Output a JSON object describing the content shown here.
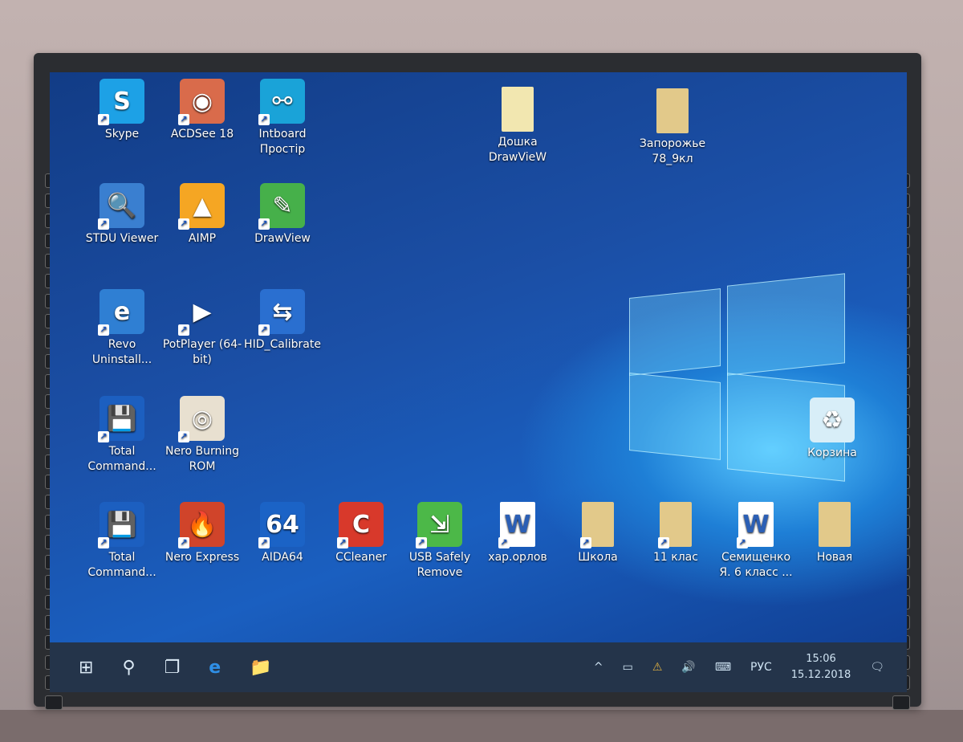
{
  "desktop": {
    "icons": [
      {
        "label": "Skype",
        "color": "#1da1e6",
        "glyph": "S"
      },
      {
        "label": "ACDSee 18",
        "color": "#d96b4b",
        "glyph": "◉"
      },
      {
        "label": "Intboard Простір",
        "color": "#1aa3d8",
        "glyph": "⚯"
      },
      {
        "label": "Дошка DrawVieW",
        "color": "#f2e7b0",
        "glyph": "",
        "folder": true
      },
      {
        "label": "Запорожье 78_9кл",
        "color": "#e2c98a",
        "glyph": "",
        "folder": true
      },
      {
        "label": "STDU Viewer",
        "color": "#3a7fd0",
        "glyph": "🔍"
      },
      {
        "label": "AIMP",
        "color": "#f5a623",
        "glyph": "▲"
      },
      {
        "label": "DrawView",
        "color": "#46b04a",
        "glyph": "✎"
      },
      {
        "label": "Revo Uninstall...",
        "color": "#2f7fd3",
        "glyph": "e"
      },
      {
        "label": "PotPlayer (64-bit)",
        "color": "#ffffff",
        "glyph": "▶"
      },
      {
        "label": "HID_Calibrate",
        "color": "#2a6fd0",
        "glyph": "⇆"
      },
      {
        "label": "Total Command...",
        "color": "#1c5fc0",
        "glyph": "💾"
      },
      {
        "label": "Nero Burning ROM",
        "color": "#e8e0d0",
        "glyph": "◎"
      },
      {
        "label": "Total Command...",
        "color": "#1c5fc0",
        "glyph": "💾"
      },
      {
        "label": "Nero Express",
        "color": "#d0442a",
        "glyph": "🔥"
      },
      {
        "label": "AIDA64",
        "color": "#1b63c6",
        "glyph": "64"
      },
      {
        "label": "CCleaner",
        "color": "#d8392b",
        "glyph": "C"
      },
      {
        "label": "USB Safely Remove",
        "color": "#4cb848",
        "glyph": "⇲"
      },
      {
        "label": "хар.орлов",
        "color": "#ffffff",
        "glyph": "W",
        "doc": true
      },
      {
        "label": "Школа",
        "color": "#e2c98a",
        "glyph": "",
        "folder": true
      },
      {
        "label": "11 клас",
        "color": "#e2c98a",
        "glyph": "",
        "folder": true
      },
      {
        "label": "Семищенко Я. 6 класс ...",
        "color": "#ffffff",
        "glyph": "W",
        "doc": true
      },
      {
        "label": "Новая",
        "color": "#e2c98a",
        "glyph": "",
        "folder": true
      },
      {
        "label": "Корзина",
        "color": "#d8eef8",
        "glyph": "♻"
      }
    ]
  },
  "taskbar": {
    "start": "⊞",
    "search": "⚲",
    "taskview": "❐",
    "edge": "e",
    "explorer": "📁",
    "tray_chevron": "^",
    "battery": "▭",
    "network": "⚠",
    "volume": "🔊",
    "keyboard": "⌨",
    "language": "РУС",
    "time": "15:06",
    "date": "15.12.2018",
    "notifications": "🗨"
  }
}
